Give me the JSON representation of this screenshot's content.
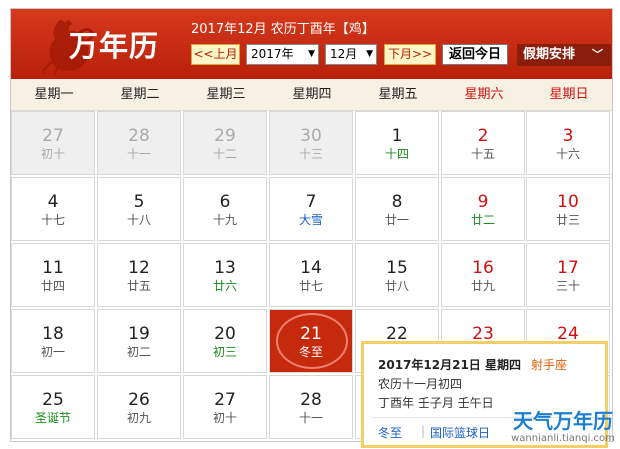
{
  "header": {
    "brand": "万年历",
    "date_line": "2017年12月  农历丁酉年【鸡】",
    "prev_month": "<<上月",
    "year_select": "2017年",
    "month_select": "12月",
    "next_month": "下月>>",
    "today_button": "返回今日",
    "holiday_button": "假期安排"
  },
  "weekdays": [
    "星期一",
    "星期二",
    "星期三",
    "星期四",
    "星期五",
    "星期六",
    "星期日"
  ],
  "rows": [
    [
      {
        "day": "27",
        "lunar": "初十",
        "other_month": true
      },
      {
        "day": "28",
        "lunar": "十一",
        "other_month": true
      },
      {
        "day": "29",
        "lunar": "十二",
        "other_month": true
      },
      {
        "day": "30",
        "lunar": "十三",
        "other_month": true
      },
      {
        "day": "1",
        "lunar": "十四",
        "lunar_style": "green"
      },
      {
        "day": "2",
        "lunar": "十五",
        "day_style": "red"
      },
      {
        "day": "3",
        "lunar": "十六",
        "day_style": "red"
      }
    ],
    [
      {
        "day": "4",
        "lunar": "十七"
      },
      {
        "day": "5",
        "lunar": "十八"
      },
      {
        "day": "6",
        "lunar": "十九"
      },
      {
        "day": "7",
        "lunar": "大雪",
        "lunar_style": "blue"
      },
      {
        "day": "8",
        "lunar": "廿一"
      },
      {
        "day": "9",
        "lunar": "廿二",
        "day_style": "red",
        "lunar_style": "green"
      },
      {
        "day": "10",
        "lunar": "廿三",
        "day_style": "red"
      }
    ],
    [
      {
        "day": "11",
        "lunar": "廿四"
      },
      {
        "day": "12",
        "lunar": "廿五"
      },
      {
        "day": "13",
        "lunar": "廿六",
        "lunar_style": "green"
      },
      {
        "day": "14",
        "lunar": "廿七"
      },
      {
        "day": "15",
        "lunar": "廿八"
      },
      {
        "day": "16",
        "lunar": "廿九",
        "day_style": "red"
      },
      {
        "day": "17",
        "lunar": "三十",
        "day_style": "red"
      }
    ],
    [
      {
        "day": "18",
        "lunar": "初一"
      },
      {
        "day": "19",
        "lunar": "初二"
      },
      {
        "day": "20",
        "lunar": "初三",
        "lunar_style": "green"
      },
      {
        "day": "21",
        "lunar": "冬至",
        "today": true
      },
      {
        "day": "22",
        "lunar": ""
      },
      {
        "day": "23",
        "lunar": "",
        "day_style": "red"
      },
      {
        "day": "24",
        "lunar": "",
        "day_style": "red"
      }
    ],
    [
      {
        "day": "25",
        "lunar": "圣诞节",
        "lunar_style": "green"
      },
      {
        "day": "26",
        "lunar": "初九"
      },
      {
        "day": "27",
        "lunar": "初十"
      },
      {
        "day": "28",
        "lunar": "十一"
      },
      {
        "day": "",
        "lunar": ""
      },
      {
        "day": "",
        "lunar": ""
      },
      {
        "day": "",
        "lunar": ""
      }
    ]
  ],
  "popup": {
    "date": "2017年12月21日  星期四",
    "sign": "射手座",
    "lunar": "农历十一月初四",
    "ganzhi": "丁酉年  壬子月  壬午日",
    "term": "冬至",
    "festival": "国际篮球日"
  },
  "watermark": {
    "title": "天气万年历",
    "url": "wannianli.tianqi.com"
  },
  "colors": {
    "header_red": "#c62a0c",
    "weekend_red": "#d01010",
    "festival_green": "#1c8a1c",
    "solar_term_blue": "#1a5fc6",
    "popup_border": "#f4cf66"
  }
}
